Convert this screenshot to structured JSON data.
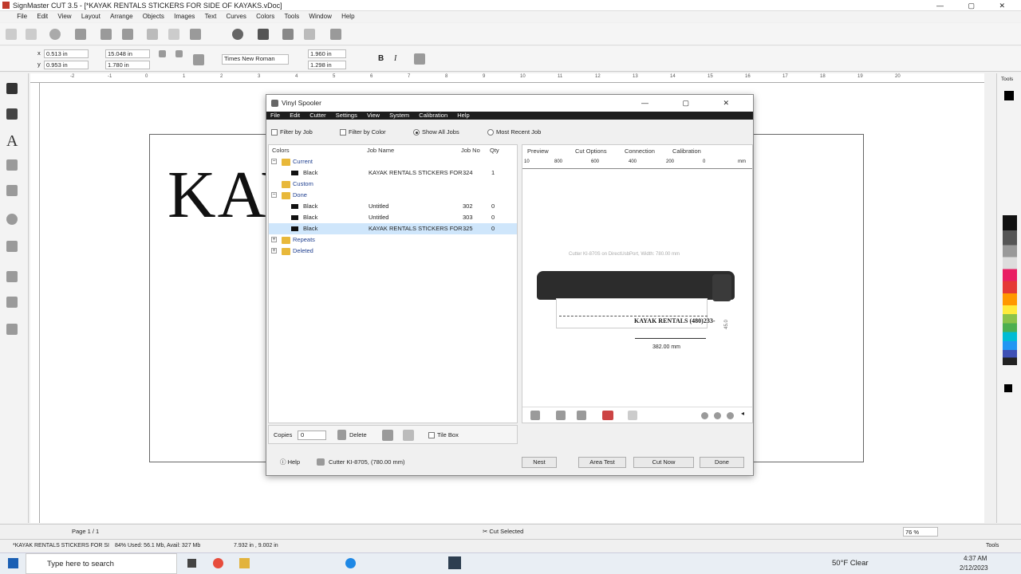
{
  "app": {
    "title": "SignMaster CUT 3.5 - [*KAYAK RENTALS STICKERS FOR SIDE OF KAYAKS.vDoc]",
    "menu": [
      "File",
      "Edit",
      "View",
      "Layout",
      "Arrange",
      "Objects",
      "Images",
      "Text",
      "Curves",
      "Colors",
      "Tools",
      "Window",
      "Help"
    ]
  },
  "props": {
    "x": "0.513 in",
    "y": "0.953 in",
    "w": "15.048 in",
    "h": "1.780 in",
    "font": "Times New Roman",
    "size1": "1.960 in",
    "size2": "1.298 in"
  },
  "ruler_ticks": [
    "-2",
    "-1",
    "0",
    "1",
    "2",
    "3",
    "4",
    "5",
    "6",
    "7",
    "8",
    "9",
    "10",
    "11",
    "12",
    "13",
    "14",
    "15",
    "16",
    "17",
    "18",
    "19",
    "20"
  ],
  "canvas_text": "KAYA",
  "dialog": {
    "title": "Vinyl Spooler",
    "menu": [
      "File",
      "Edit",
      "Cutter",
      "Settings",
      "View",
      "System",
      "Calibration",
      "Help"
    ],
    "filters": {
      "filter_job": "Filter by Job",
      "filter_color": "Filter by Color",
      "show_all": "Show All Jobs",
      "most_recent": "Most Recent Job"
    },
    "columns": {
      "colors": "Colors",
      "job_name": "Job Name",
      "job_no": "Job No",
      "qty": "Qty"
    },
    "rows": [
      {
        "type": "group",
        "label": "Current",
        "toggle": "−"
      },
      {
        "type": "job",
        "color": "Black",
        "name": "KAYAK RENTALS STICKERS FOR ...",
        "no": "324",
        "qty": "1"
      },
      {
        "type": "group",
        "label": "Custom",
        "toggle": ""
      },
      {
        "type": "group",
        "label": "Done",
        "toggle": "−"
      },
      {
        "type": "job",
        "color": "Black",
        "name": "Untitled",
        "no": "302",
        "qty": "0"
      },
      {
        "type": "job",
        "color": "Black",
        "name": "Untitled",
        "no": "303",
        "qty": "0"
      },
      {
        "type": "job",
        "color": "Black",
        "name": "KAYAK RENTALS STICKERS FOR ...",
        "no": "325",
        "qty": "0"
      },
      {
        "type": "group",
        "label": "Repeats",
        "toggle": "+"
      },
      {
        "type": "group",
        "label": "Deleted",
        "toggle": "+"
      }
    ],
    "preview_tabs": [
      "Preview",
      "Cut Options",
      "Connection",
      "Calibration"
    ],
    "ruler_labels": [
      "10",
      "800",
      "600",
      "400",
      "200",
      "0",
      "mm"
    ],
    "cutter_info": "Cutter KI-870S on DirectUsbPort,   Width: 780.00 mm",
    "sticker_text": "KAYAK RENTALS (480)233-",
    "dimension": "382.00 mm",
    "side_dim": "45.0",
    "copies_label": "Copies",
    "copies_value": "0",
    "delete_label": "Delete",
    "tile_box": "Tile Box",
    "help": "Help",
    "cutter_status": "Cutter KI-8705, (780.00 mm)",
    "buttons": {
      "nest": "Nest",
      "area_test": "Area Test",
      "cut_now": "Cut Now",
      "done": "Done"
    }
  },
  "status": {
    "cut_selected": "Cut Selected",
    "page": "Page 1 / 1",
    "zoom": "76 %",
    "tools": "Tools",
    "doc_tab": "*KAYAK RENTALS STICKERS FOR SI",
    "mem": "84%  Used: 56.1 Mb, Avail: 327 Mb",
    "coords": "7.932 in , 9.002 in"
  },
  "taskbar": {
    "search": "Type here to search",
    "weather": "50°F  Clear",
    "time": "4:37 AM",
    "date": "2/12/2023"
  },
  "colors": {
    "accent": "#1d1d1d",
    "selected_row": "#cfe6fb",
    "group_text": "#1f3f8f"
  }
}
